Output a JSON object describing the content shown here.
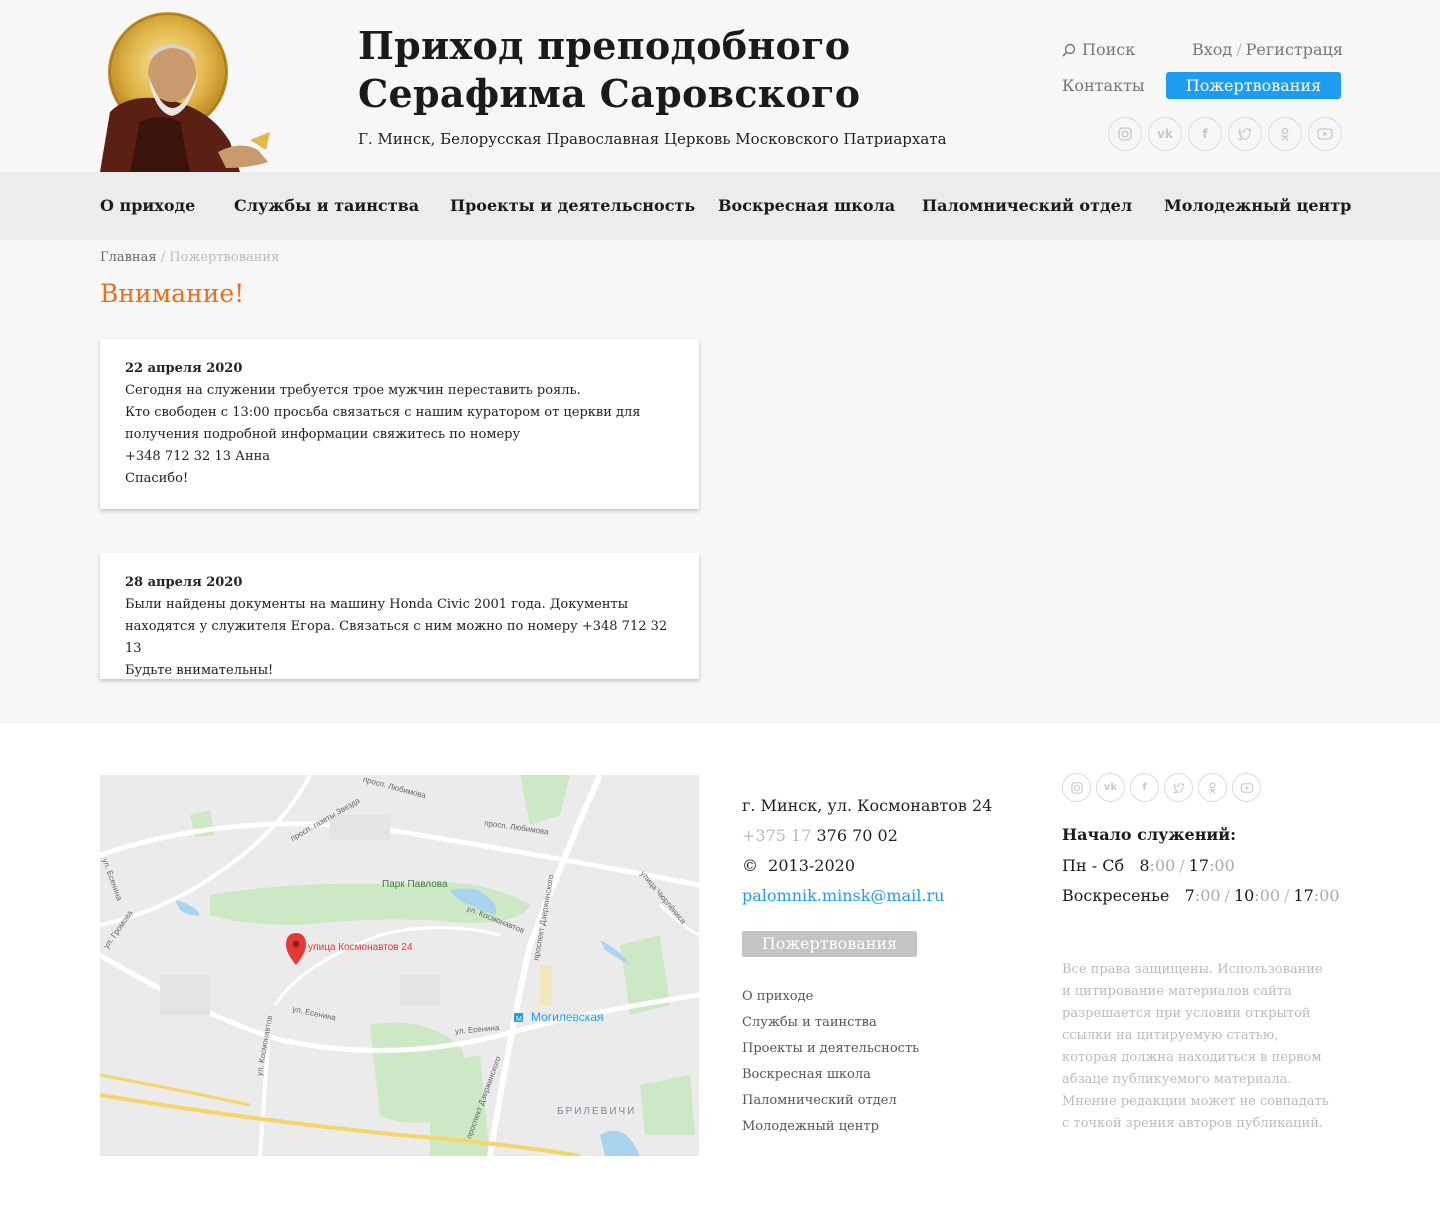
{
  "header": {
    "title_line1": "Приход преподобного",
    "title_line2": "Серафима Саровского",
    "subtitle": "Г. Минск, Белорусская Православная Церковь Московского Патриархата",
    "search_label": "Поиск",
    "login_label": "Вход",
    "login_sep": "/",
    "register_label": "Регистраця",
    "contacts_label": "Контакты",
    "donate_label": "Пожертвования",
    "socials": [
      "instagram-icon",
      "vk-icon",
      "facebook-icon",
      "twitter-icon",
      "odnoklassniki-icon",
      "youtube-icon"
    ]
  },
  "nav": {
    "items": [
      {
        "label": "О приходе"
      },
      {
        "label": "Службы и таинства"
      },
      {
        "label": "Проекты и деятельсность"
      },
      {
        "label": "Воскресная школа"
      },
      {
        "label": "Паломнический отдел"
      },
      {
        "label": "Молодежный центр"
      }
    ]
  },
  "breadcrumb": {
    "home": "Главная",
    "sep": " / ",
    "current": "Пожертвования"
  },
  "page_title": "Внимание!",
  "notices": [
    {
      "date": "22 апреля 2020",
      "lines": [
        "Сегодня на служении требуется трое мужчин переставить рояль.",
        "Кто свободен с 13:00 просьба связаться с нашим куратором от церкви для",
        "получения подробной информации  свяжитесь по номеру",
        "+348 712 32 13 Анна",
        "Спасибо!"
      ]
    },
    {
      "date": "28 апреля 2020",
      "lines": [
        "Были найдены документы на машину Honda Civic 2001 года. Документы",
        "находятся у служителя Егора. Связаться с ним можно по номеру  +348 712 32 13",
        "Будьте внимательны!"
      ]
    }
  ],
  "map": {
    "pin_label": "улица Космонавтов 24",
    "park_label": "Парк Павлова",
    "metro_label": "Могилевская",
    "district_label": "БРИЛЕВИЧИ",
    "streets": [
      "просп. Любимова",
      "просп. Любимова",
      "просп. газеты Звезда",
      "ул. Космонавтов",
      "ул. Есенина",
      "ул. Есенина",
      "ул. Космонавтов",
      "проспект Дзержинского",
      "проспект Дзержинского",
      "улица Чюрлёниса",
      "ул. Громова",
      "ул. Есенина"
    ],
    "accent_color": "#e53935"
  },
  "footer": {
    "address": "г. Минск, ул. Космонавтов 24",
    "phone_prefix": "+375 17",
    "phone_number": " 376 70 02",
    "copyright_symbol": "©",
    "copyright_years": "2013-2020",
    "email": "palomnik.minsk@mail.ru",
    "donate_label": "Пожертвования",
    "menu": [
      "О приходе",
      "Службы и таинства",
      "Проекты и деятельсность",
      "Воскресная школа",
      "Паломнический отдел",
      "Молодежный центр"
    ],
    "services_title": "Начало служений:",
    "weekday_label": "Пн - Сб",
    "weekday_times": [
      {
        "h": "8",
        "m": ":00"
      },
      {
        "h": "17",
        "m": ":00"
      }
    ],
    "sunday_label": "Воскресенье",
    "sunday_times": [
      {
        "h": "7",
        "m": ":00"
      },
      {
        "h": "10",
        "m": ":00"
      },
      {
        "h": "17",
        "m": ":00"
      }
    ],
    "rights_text": "Все права защищены. Использование и цитирование материалов сайта разрешается при условии открытой ссылки на цитируемую статью, которая должна находиться в первом абзаце публикуемого материала. Мнение редакции может не совпадать с точкой зрения авторов публикаций."
  },
  "colors": {
    "accent": "#1e9df0",
    "title_orange": "#e8701a"
  }
}
